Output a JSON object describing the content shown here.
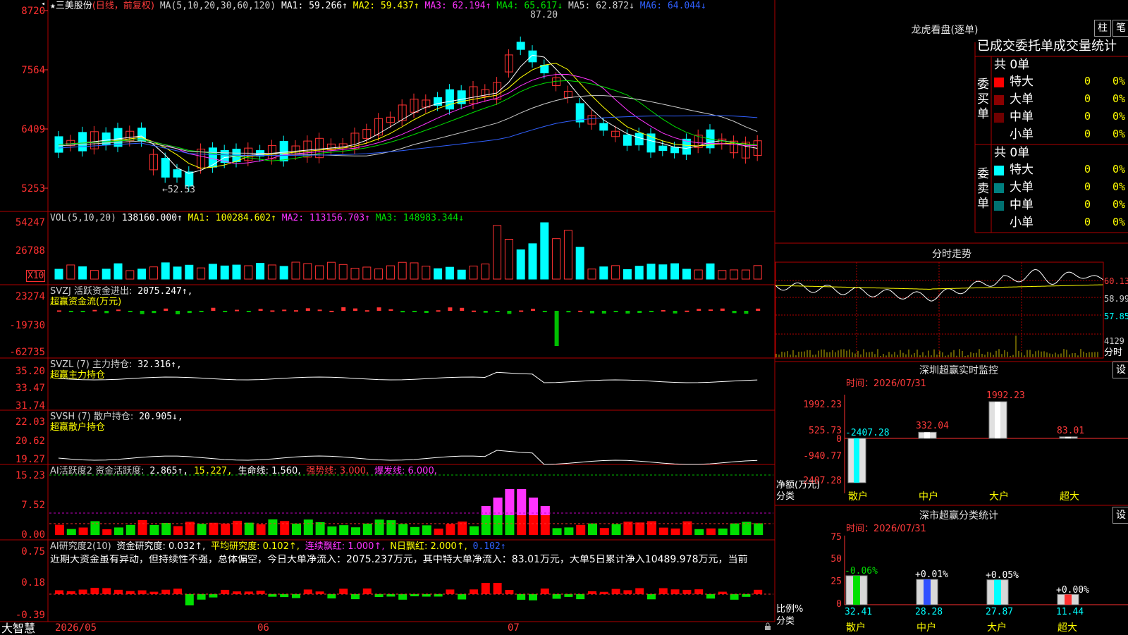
{
  "stock": {
    "star": "★",
    "name": "三美股份",
    "mode": "(日线，前复权)"
  },
  "ma_legend": {
    "label": "MA(5,10,20,30,60,120)",
    "ma1": "MA1: 59.266↑",
    "ma2": "MA2: 59.437↑",
    "ma3": "MA3: 62.194↑",
    "ma4": "MA4: 65.617↓",
    "ma5": "MA5: 62.872↓",
    "ma6": "MA6: 64.044↓"
  },
  "price_axis": [
    "8720",
    "7564",
    "6409",
    "5253"
  ],
  "price_annotations": {
    "high": "87.20",
    "low": "52.53"
  },
  "vol_legend": {
    "label": "VOL(5,10,20)",
    "value": "138160.000↑",
    "ma1": "MA1: 100284.602↑",
    "ma2": "MA2: 113156.703↑",
    "ma3": "MA3: 148983.344↓"
  },
  "vol_axis": [
    "54247",
    "26788"
  ],
  "vol_unit": "X10",
  "svzj": {
    "label": "SVZJ  活跃资金进出:",
    "value": "2075.247↑,",
    "sub": "超赢资金流(万元)",
    "axis": [
      "23274",
      "-19730",
      "-62735"
    ]
  },
  "svzl": {
    "label": "SVZL (7) 主力持仓:",
    "value": "32.316↑,",
    "sub": "超赢主力持仓",
    "axis": [
      "35.20",
      "33.47",
      "31.74"
    ]
  },
  "svsh": {
    "label": "SVSH (7) 散户持仓:",
    "value": "20.905↓,",
    "sub": "超赢散户持仓",
    "axis": [
      "22.03",
      "20.62",
      "19.27"
    ]
  },
  "ai_active": {
    "label": "AI活跃度2 资金活跃度:",
    "value": "2.865↑,",
    "v2": "15.227,",
    "life": "生命线: 1.560,",
    "strong": "强势线: 3.000,",
    "burst": "爆发线: 6.000,",
    "axis": [
      "15.23",
      "7.52",
      "0.00"
    ]
  },
  "ai_research": {
    "label": "AI研究度2(10)",
    "research": "资金研究度: 0.032↑,",
    "avg": "平均研究度: 0.102↑,",
    "cont": "连续飘红: 1.000↑,",
    "nday": "N日飘红: 2.000↑,",
    "last": "0.102↑",
    "axis": [
      "0.75",
      "0.18",
      "-0.39"
    ],
    "commentary": "近期大资金虽有异动，但持续性不强，总体偏空，今日大单净流入：2075.237万元，其中特大单净流入：83.01万元，大单5日累计净入10489.978万元，当前"
  },
  "date_axis": {
    "brand": "大智慧",
    "labels": [
      "2026/05",
      "06",
      "07"
    ]
  },
  "right_panel": {
    "dragon": {
      "title": "龙虎看盘(逐单)",
      "btn_bar": "柱",
      "btn_pen": "笔",
      "header": "已成交委托单成交量统计",
      "buy_side": "委买单",
      "sell_side": "委卖单",
      "buy_total": "共 0单",
      "sell_total": "共 0单",
      "buy_rows": [
        {
          "name": "特大",
          "count": "0",
          "pct": "0%"
        },
        {
          "name": "大单",
          "count": "0",
          "pct": "0%"
        },
        {
          "name": "中单",
          "count": "0",
          "pct": "0%"
        },
        {
          "name": "小单",
          "count": "0",
          "pct": "0%"
        }
      ],
      "sell_rows": [
        {
          "name": "特大",
          "count": "0",
          "pct": "0%"
        },
        {
          "name": "大单",
          "count": "0",
          "pct": "0%"
        },
        {
          "name": "中单",
          "count": "0",
          "pct": "0%"
        },
        {
          "name": "小单",
          "count": "0",
          "pct": "0%"
        }
      ],
      "colors": {
        "buy": [
          "#ff0000",
          "#8b0000",
          "#700000",
          "#000000"
        ],
        "sell": [
          "#00ffff",
          "#008080",
          "#007070",
          "#000000"
        ]
      }
    },
    "intraday": {
      "title": "分时走势",
      "axis": [
        "60.13",
        "58.99",
        "57.85"
      ],
      "vol_axis": "4129",
      "vol_label": "分时"
    },
    "sz_monitor": {
      "title": "深圳超赢实时监控",
      "set": "设",
      "time": "时间：2026/07/31",
      "axis": [
        "1992.23",
        "525.73",
        "0",
        "-940.77",
        "-2407.28"
      ],
      "bars": [
        {
          "cat": "散户",
          "value": -2407.28,
          "label": "-2407.28"
        },
        {
          "cat": "中户",
          "value": 332.04,
          "label": "332.04"
        },
        {
          "cat": "大户",
          "value": 1992.23,
          "label": "1992.23"
        },
        {
          "cat": "超大",
          "value": 83.01,
          "label": "83.01"
        }
      ],
      "ylabel1": "净额(万元)",
      "ylabel2": "分类"
    },
    "sz_class": {
      "title": "深市超赢分类统计",
      "set": "设",
      "time": "时间：2026/07/31",
      "axis": [
        "75",
        "50",
        "25",
        "0"
      ],
      "bars": [
        {
          "cat": "散户",
          "value": 32.41,
          "change": "-0.06%"
        },
        {
          "cat": "中户",
          "value": 28.28,
          "change": "+0.01%"
        },
        {
          "cat": "大户",
          "value": 27.87,
          "change": "+0.05%"
        },
        {
          "cat": "超大",
          "value": 11.44,
          "change": "+0.00%"
        }
      ],
      "ylabel1": "比例%",
      "ylabel2": "分类"
    }
  },
  "colors": {
    "up": "#ff3232",
    "down": "#00ffff",
    "grid": "#b00000"
  }
}
